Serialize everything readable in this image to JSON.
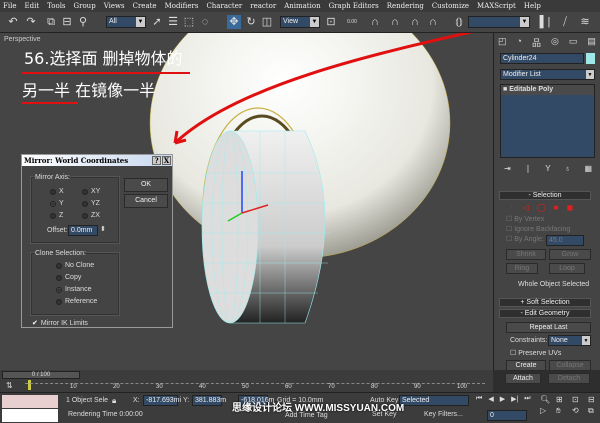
{
  "menu": [
    "File",
    "Edit",
    "Tools",
    "Group",
    "Views",
    "Create",
    "Modifiers",
    "Character",
    "reactor",
    "Animation",
    "Graph Editors",
    "Rendering",
    "Customize",
    "MAXScript",
    "Help"
  ],
  "toolbar": {
    "selection_filter": "All",
    "ref_coord": "View",
    "spinner_snap": "0.00"
  },
  "viewport": {
    "label": "Perspective",
    "annotation_line1": "56.选择面  删掉物体的",
    "annotation_line2": "另一半  在镜像一半",
    "annotation_color": "#e01010"
  },
  "dialog": {
    "title": "Mirror: World Coordinates",
    "help": "?",
    "close": "X",
    "mirror_axis_label": "Mirror Axis:",
    "axes": [
      "X",
      "Y",
      "Z",
      "XY",
      "YZ",
      "ZX"
    ],
    "selected_axis": "Y",
    "offset_label": "Offset:",
    "offset_value": "0.0mm",
    "ok": "OK",
    "cancel": "Cancel",
    "clone_label": "Clone Selection:",
    "clone_options": [
      "No Clone",
      "Copy",
      "Instance",
      "Reference"
    ],
    "selected_clone": "Instance",
    "mirror_ik": "Mirror IK Limits"
  },
  "panel": {
    "object_name": "Cylinder24",
    "object_color": "#a0e8e8",
    "modifier_list": "Modifier List",
    "stack_item": "Editable Poly",
    "selection_rollout": "Selection",
    "by_vertex": "By Vertex",
    "ignore_backfacing": "Ignore Backfacing",
    "by_angle": "By Angle:",
    "angle_value": "45.0",
    "shrink": "Shrink",
    "grow": "Grow",
    "ring": "Ring",
    "loop": "Loop",
    "selection_status": "Whole Object Selected",
    "soft_selection": "Soft Selection",
    "edit_geometry": "Edit Geometry",
    "repeat_last": "Repeat Last",
    "constraints_label": "Constraints:",
    "constraints_value": "None",
    "preserve_uvs": "Preserve UVs",
    "create": "Create",
    "collapse": "Collapse",
    "attach": "Attach",
    "detach": "Detach"
  },
  "timeline": {
    "frame": "0 / 100",
    "ticks": [
      "10",
      "20",
      "30",
      "40",
      "50",
      "60",
      "70",
      "80",
      "90",
      "100"
    ]
  },
  "status": {
    "selection": "1 Object Sele",
    "x_label": "X:",
    "x_value": "-817.693mi",
    "y_label": "Y:",
    "y_value": "381.883m",
    "z_value": "-618.016m",
    "grid": "Grid = 10.0mm",
    "rendering_time": "Rendering Time  0:00:00",
    "add_time_tag": "Add Time Tag",
    "auto_key": "Auto Key",
    "key_mode": "Selected",
    "set_key": "Set Key",
    "key_filters": "Key Filters...",
    "current_frame": "0"
  },
  "watermark": "思缘设计论坛 WWW.MISSYUAN.COM"
}
